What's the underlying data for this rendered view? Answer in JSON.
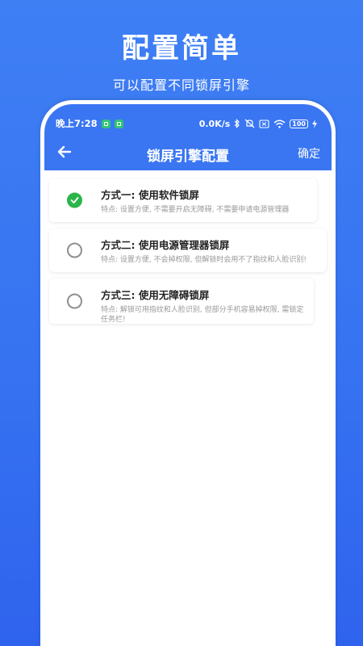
{
  "promo": {
    "title": "配置简单",
    "subtitle": "可以配置不同锁屏引擎"
  },
  "status_bar": {
    "time": "晚上7:28",
    "speed": "0.0K/s",
    "battery": "100"
  },
  "nav": {
    "title": "锁屏引擎配置",
    "confirm_label": "确定"
  },
  "options": [
    {
      "title": "方式一: 使用软件锁屏",
      "desc": "特点: 设置方便, 不需要开启无障碍, 不需要申请电源管理器",
      "selected": true
    },
    {
      "title": "方式二: 使用电源管理器锁屏",
      "desc": "特点: 设置方便, 不会掉权限, 但解锁时会用不了指纹和人脸识别!",
      "selected": false
    },
    {
      "title": "方式三: 使用无障碍锁屏",
      "desc": "特点: 解锁可用指纹和人脸识别, 但部分手机容易掉权限, 需锁定任务栏!",
      "selected": false
    }
  ],
  "colors": {
    "background": "#3a76f2",
    "header": "#3a76f2",
    "selected": "#2cb54a"
  }
}
